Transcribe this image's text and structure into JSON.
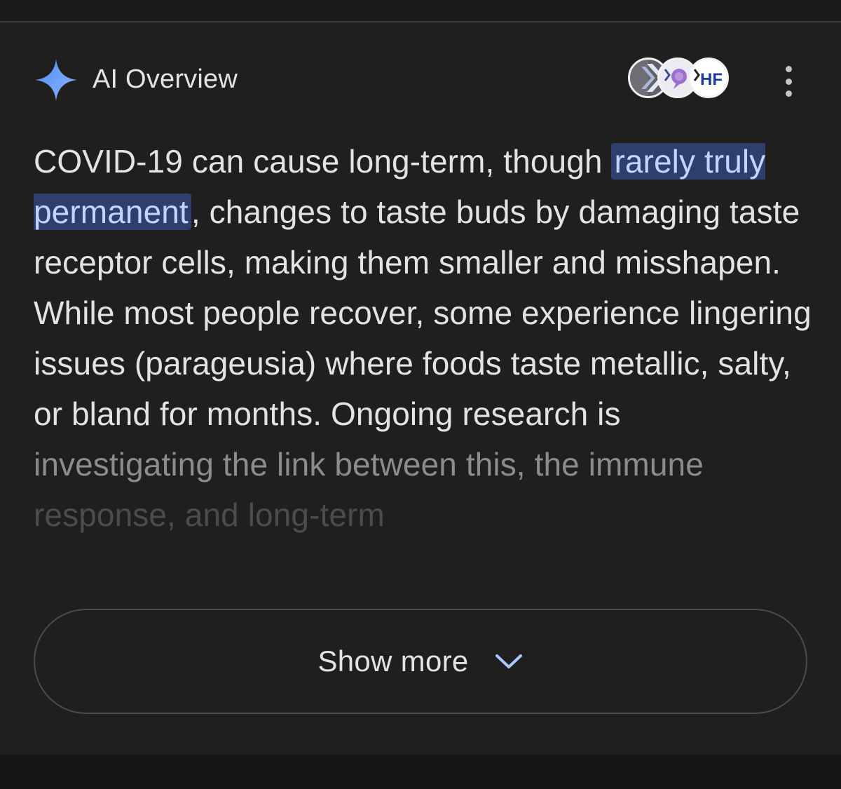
{
  "header": {
    "title": "AI Overview",
    "icon": "sparkle-icon",
    "sparkle_color": "#6f9dfa",
    "sources": [
      {
        "name": "source-1",
        "icon": "chevron-logo-icon"
      },
      {
        "name": "source-2",
        "icon": "speech-bubble-logo-icon"
      },
      {
        "name": "source-3",
        "icon": "hf-logo-icon",
        "label": "HF"
      }
    ],
    "more_icon": "more-vert-icon"
  },
  "overview": {
    "text_before": "COVID-19 can cause long-term, though ",
    "highlight": "rarely truly permanent",
    "text_after": ", changes to taste buds by damaging taste receptor cells, making them smaller and misshapen. While most people recover, some experience lingering issues (parageusia) where foods taste metallic, salty, or bland for months. Ongoing research is",
    "faded_line_1": "investigating the link between this, the immune",
    "faded_line_2": "response, and long-term",
    "highlight_color": "#2e3e6d"
  },
  "show_more": {
    "label": "Show more",
    "icon": "chevron-down-icon",
    "chevron_color": "#a8c7fa"
  }
}
